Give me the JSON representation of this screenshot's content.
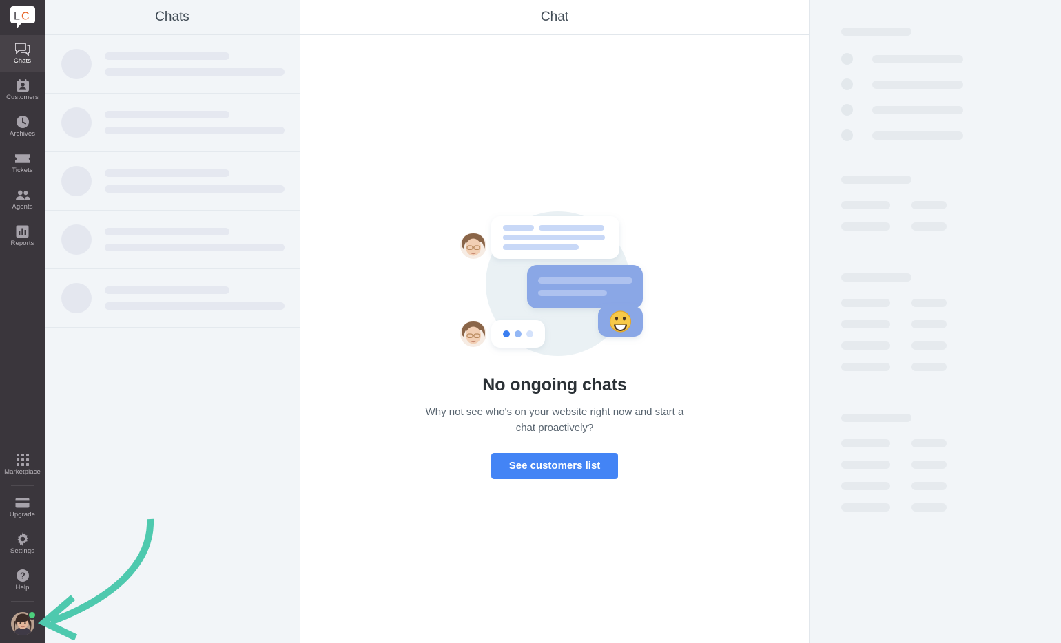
{
  "brand": {
    "logo_text_left": "L",
    "logo_text_right": "C",
    "logo_name": "LiveChat",
    "logo_color_left": "#3f3b41",
    "logo_color_right": "#e8662a"
  },
  "sidebar": {
    "items": [
      {
        "label": "Chats",
        "icon": "chat-bubble-icon",
        "active": true
      },
      {
        "label": "Customers",
        "icon": "customer-card-icon",
        "active": false
      },
      {
        "label": "Archives",
        "icon": "clock-icon",
        "active": false
      },
      {
        "label": "Tickets",
        "icon": "ticket-icon",
        "active": false
      },
      {
        "label": "Agents",
        "icon": "people-icon",
        "active": false
      },
      {
        "label": "Reports",
        "icon": "bar-chart-icon",
        "active": false
      }
    ],
    "bottom_items": [
      {
        "label": "Marketplace",
        "icon": "grid-dots-icon"
      },
      {
        "label": "Upgrade",
        "icon": "credit-card-icon"
      },
      {
        "label": "Settings",
        "icon": "gear-icon"
      },
      {
        "label": "Help",
        "icon": "question-circle-icon"
      }
    ],
    "profile": {
      "name": "agent-avatar",
      "status": "online",
      "status_color": "#4cd07d"
    },
    "background_color": "#3a363c",
    "active_background_color": "#474248"
  },
  "chats_panel": {
    "title": "Chats",
    "skeleton_rows": [
      {
        "id": 1
      },
      {
        "id": 2
      },
      {
        "id": 3
      },
      {
        "id": 4
      },
      {
        "id": 5
      }
    ]
  },
  "chat_panel": {
    "title": "Chat",
    "empty_state": {
      "heading": "No ongoing chats",
      "description": "Why not see who's on your website right now and start a chat proactively?",
      "button_label": "See customers list",
      "button_color": "#4384f5",
      "illustration": "chat-conversation-illustration"
    }
  },
  "details_panel": {
    "sections": [
      {
        "header": true,
        "rows": [
          {
            "type": "circle-bar"
          },
          {
            "type": "circle-bar"
          },
          {
            "type": "circle-bar"
          },
          {
            "type": "circle-bar"
          }
        ]
      },
      {
        "header": true,
        "rows": [
          {
            "type": "pair"
          },
          {
            "type": "pair"
          }
        ]
      },
      {
        "header": true,
        "rows": [
          {
            "type": "pair"
          },
          {
            "type": "pair"
          },
          {
            "type": "pair"
          },
          {
            "type": "pair"
          },
          {
            "type": "pair"
          }
        ]
      },
      {
        "header": true,
        "rows": [
          {
            "type": "pair"
          },
          {
            "type": "pair"
          },
          {
            "type": "pair"
          },
          {
            "type": "pair"
          },
          {
            "type": "pair"
          }
        ]
      }
    ]
  },
  "annotation": {
    "type": "curved-arrow",
    "color": "#4ec9ae",
    "points_to": "agent-avatar"
  }
}
